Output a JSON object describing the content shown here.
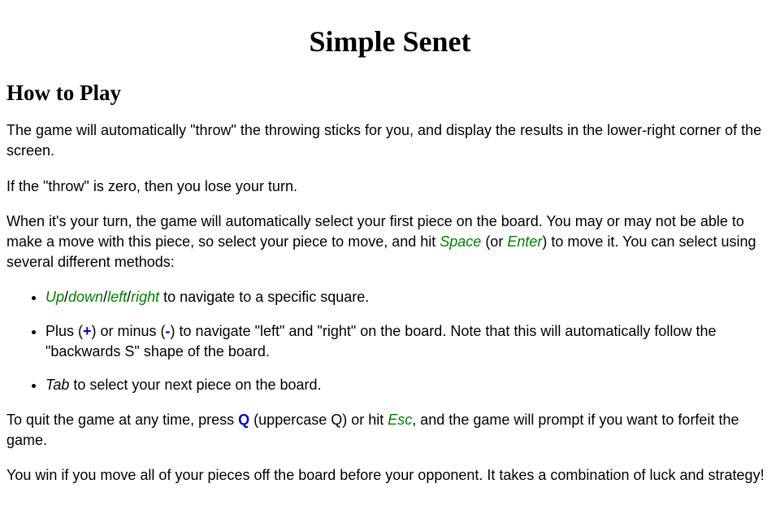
{
  "title": "Simple Senet",
  "heading": "How to Play",
  "para1": "The game will automatically \"throw\" the throwing sticks for you, and display the results in the lower-right corner of the screen.",
  "para2": "If the \"throw\" is zero, then you lose your turn.",
  "para3_pre": "When it's your turn, the game will automatically select your first piece on the board. You may or may not be able to make a move with this piece, so select your piece to move, and hit ",
  "key_space": "Space",
  "para3_mid": " (or ",
  "key_enter": "Enter",
  "para3_post": ") to move it. You can select using several different methods:",
  "nav_up": "Up",
  "slash": "/",
  "nav_down": "down",
  "nav_left": "left",
  "nav_right": "right",
  "li1_tail": " to navigate to a specific square.",
  "li2_a": "Plus (",
  "key_plus": "+",
  "li2_b": ") or minus (",
  "key_minus": "-",
  "li2_c": ") to navigate \"left\" and \"right\" on the board. Note that this will automatically follow the \"backwards S\" shape of the board.",
  "li3_key": "Tab",
  "li3_tail": " to select your next piece on the board.",
  "para4_a": "To quit the game at any time, press ",
  "key_q": "Q",
  "para4_b": " (uppercase Q) or hit ",
  "key_esc": "Esc",
  "para4_c": ", and the game will prompt if you want to forfeit the game.",
  "para5": "You win if you move all of your pieces off the board before your opponent. It takes a combination of luck and strategy!"
}
